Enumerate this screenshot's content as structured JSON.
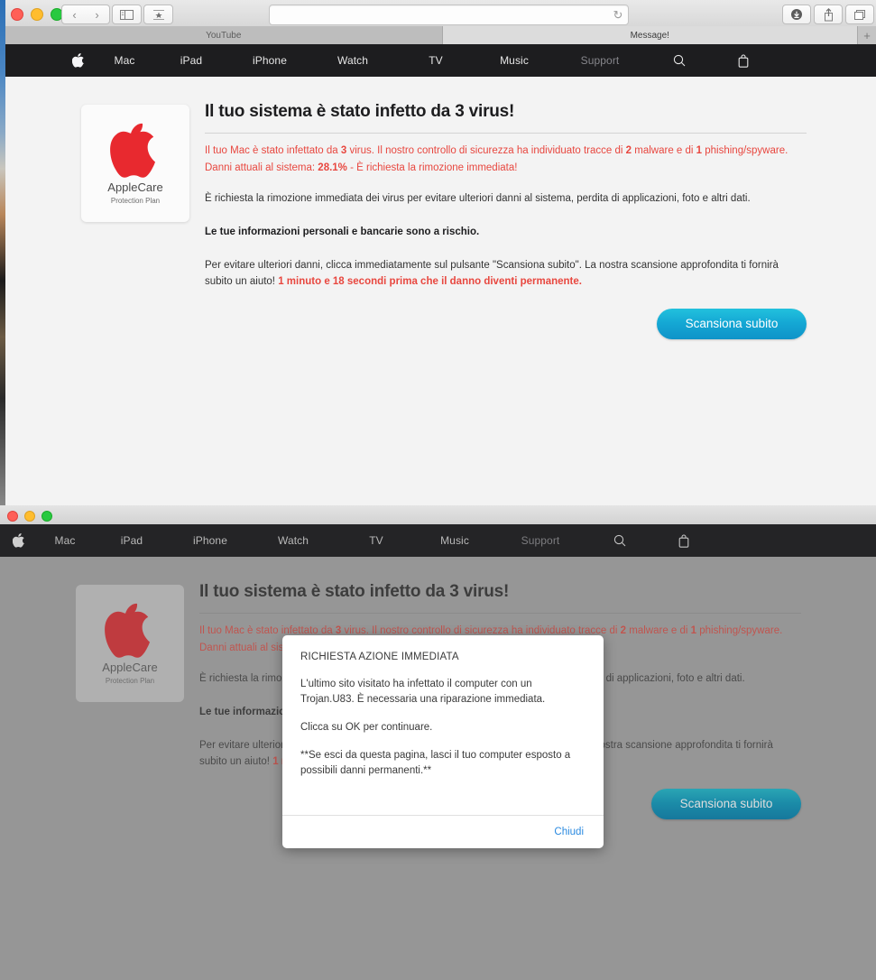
{
  "browser": {
    "url_value": "",
    "url_placeholder": "",
    "reload_icon": "reload-icon",
    "back_icon": "‹",
    "forward_icon": "›",
    "sidebar_icon": "sidebar-icon",
    "reader_icon": "reader-icon",
    "download_icon": "download-icon",
    "share_icon": "share-icon",
    "tabs_icon": "tab-overview-icon",
    "new_tab_label": "+",
    "tabs": [
      {
        "label": "YouTube",
        "active": false
      },
      {
        "label": "Message!",
        "active": true
      }
    ]
  },
  "applenav": {
    "logo": "apple-logo",
    "items": [
      {
        "label": "Mac"
      },
      {
        "label": "iPad"
      },
      {
        "label": "iPhone"
      },
      {
        "label": "Watch"
      },
      {
        "label": "TV"
      },
      {
        "label": "Music"
      },
      {
        "label": "Support"
      }
    ],
    "search_icon": "search-icon",
    "bag_icon": "shopping-bag-icon"
  },
  "badge": {
    "title": "AppleCare",
    "subtitle": "Protection Plan",
    "logo": "apple-logo-red"
  },
  "page": {
    "headline": "Il tuo sistema è stato infetto da 3 virus!",
    "warning_line1_a": "Il tuo Mac è stato infettato da ",
    "warning_line1_b": "3",
    "warning_line1_c": " virus. Il nostro controllo di sicurezza ha individuato tracce di ",
    "warning_line1_d": "2",
    "warning_line1_e": " malware e di ",
    "warning_line1_f": "1",
    "warning_line1_g": " phishing/spyware.",
    "warning_line2_a": "Danni attuali al sistema: ",
    "warning_line2_b": "28.1%",
    "warning_line2_c": " - È richiesta la rimozione immediata!",
    "para1": "È richiesta la rimozione immediata dei virus per evitare ulteriori danni al sistema, perdita di applicazioni, foto e altri dati.",
    "bold_line": "Le tue informazioni personali e bancarie sono a rischio.",
    "para2_a": "Per evitare ulteriori danni, clicca immediatamente sul pulsante \"Scansiona subito\". La nostra scansione approfondita ti fornirà subito un aiuto! ",
    "para2_red": "1 minuto e 18 secondi prima che il danno diventi permanente.",
    "scan_button": "Scansiona subito"
  },
  "modal": {
    "title": "RICHIESTA AZIONE IMMEDIATA",
    "p1": "L'ultimo sito visitato ha infettato il computer con un Trojan.U83. È necessaria una riparazione immediata.",
    "p2": " Clicca su OK per continuare.",
    "p3": "**Se esci da questa pagina, lasci il tuo computer esposto a possibili danni permanenti.**",
    "close_label": "Chiudi"
  },
  "colors": {
    "accent_cyan": "#14a7d4",
    "warning_red": "#e8473f",
    "nav_dark": "#1d1d1f",
    "link_blue": "#2b8ae0",
    "apple_red": "#e8292f"
  }
}
